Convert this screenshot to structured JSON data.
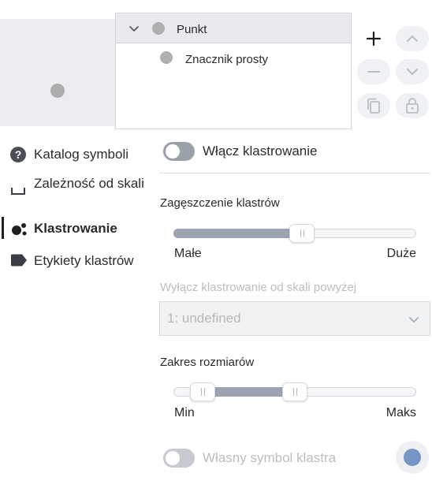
{
  "tree": {
    "parent_label": "Punkt",
    "child_label": "Znacznik prosty"
  },
  "sidebar": {
    "items": [
      {
        "label": "Katalog symboli",
        "icon": "help-circle-icon"
      },
      {
        "label": "Zależność od skali",
        "icon": "scale-range-icon"
      },
      {
        "label": "Klastrowanie",
        "icon": "cluster-icon",
        "active": true
      },
      {
        "label": "Etykiety klastrów",
        "icon": "label-tag-icon"
      }
    ]
  },
  "clustering": {
    "enable_label": "Włącz klastrowanie",
    "enabled": false,
    "density_title": "Zagęszczenie klastrów",
    "density_min_label": "Małe",
    "density_max_label": "Duże",
    "density_value": 0.53,
    "disable_scale_title": "Wyłącz klastrowanie od skali powyżej",
    "disable_scale_value": "1: undefined",
    "size_range_title": "Zakres rozmiarów",
    "size_min_label": "Min",
    "size_max_label": "Maks",
    "size_range_low": 0.12,
    "size_range_high": 0.5,
    "custom_symbol_label": "Własny symbol klastra",
    "custom_symbol_enabled": false,
    "cluster_color": "#7796c6"
  },
  "colors": {
    "toggle_off": "#9aa1ab",
    "slider_fill": "#9aa4b2",
    "symbol_gray": "#adadad"
  }
}
